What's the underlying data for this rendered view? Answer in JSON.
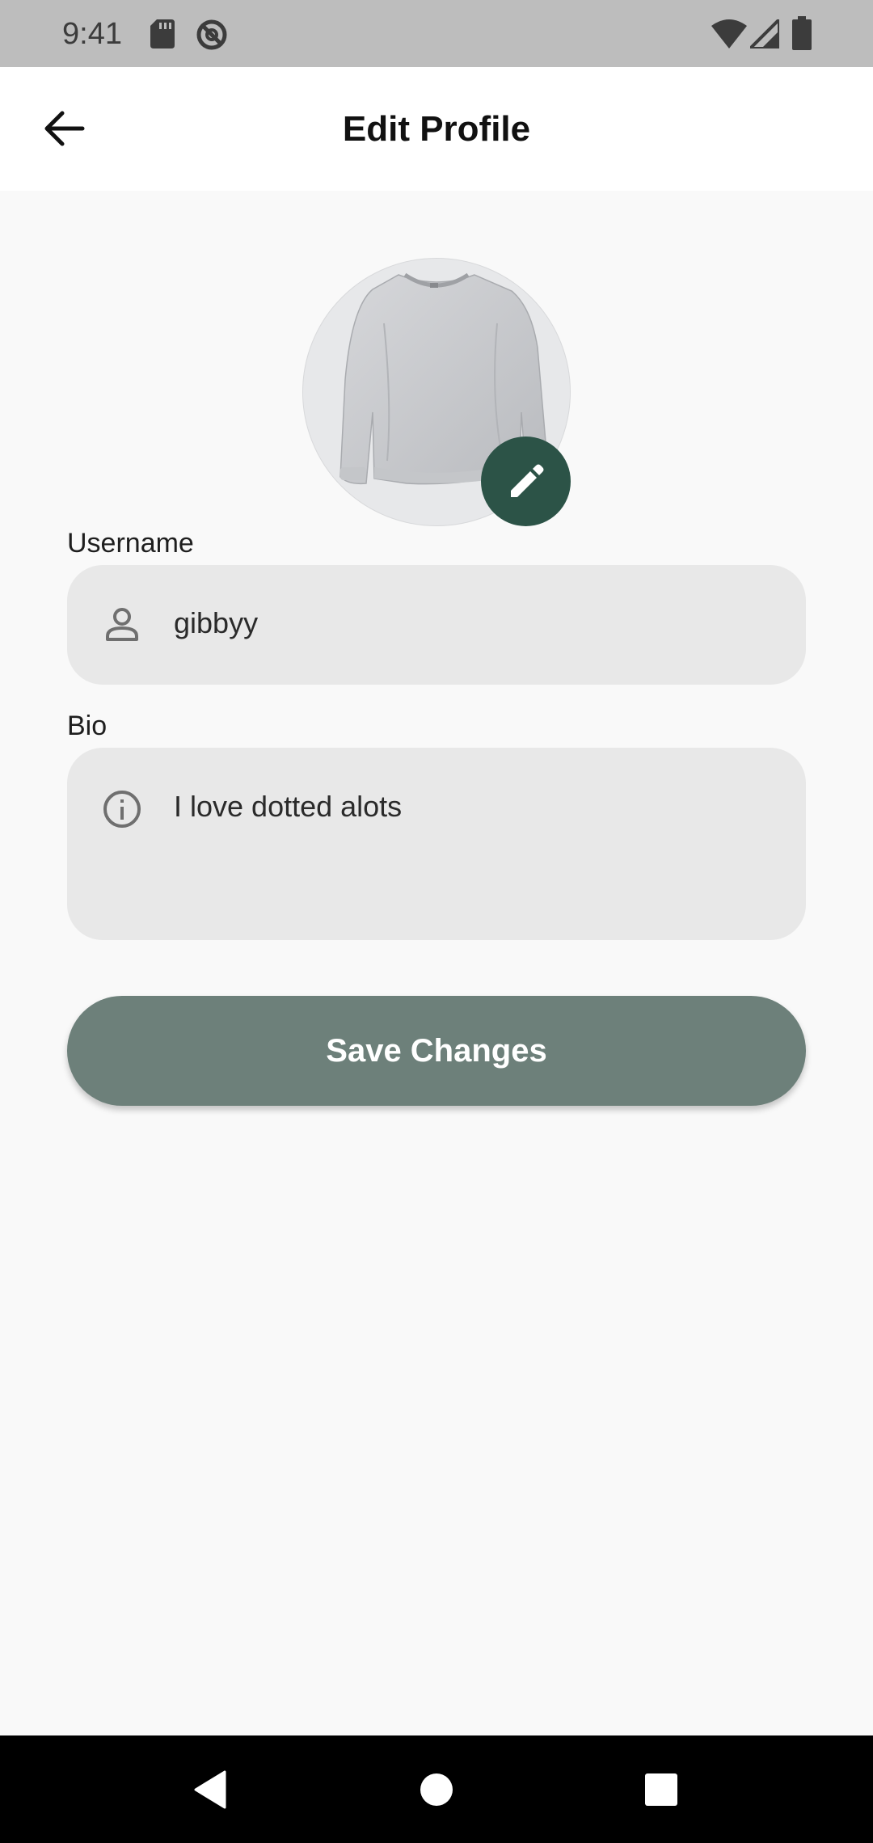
{
  "status_bar": {
    "time": "9:41",
    "icons": [
      "sd-card-icon",
      "do-not-disturb-icon",
      "wifi-icon",
      "signal-icon",
      "battery-icon"
    ]
  },
  "app_bar": {
    "title": "Edit Profile",
    "back_icon": "arrow-left-icon"
  },
  "avatar": {
    "image": "sweatshirt-image",
    "edit_icon": "pencil-icon",
    "edit_button_color": "#2c5347"
  },
  "form": {
    "username": {
      "label": "Username",
      "value": "gibbyy",
      "icon": "person-icon"
    },
    "bio": {
      "label": "Bio",
      "value": "I love dotted alots",
      "icon": "info-icon"
    },
    "field_background": "#e8e8e8"
  },
  "save_button": {
    "label": "Save Changes",
    "color": "#6d807a"
  },
  "nav_bar": {
    "items": [
      "back-triangle-icon",
      "home-circle-icon",
      "recents-square-icon"
    ]
  }
}
